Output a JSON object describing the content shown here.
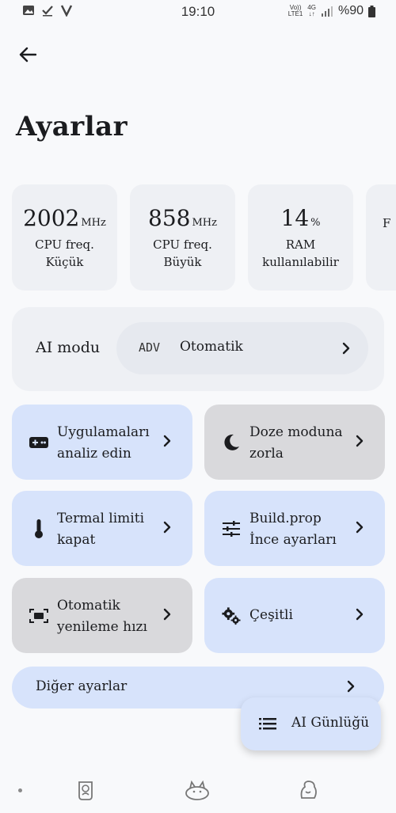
{
  "status_bar": {
    "time": "19:10",
    "network_top": "Vo))",
    "network_bottom": "LTE1",
    "signal_type": "4G",
    "battery": "%90",
    "left_icons": [
      "gallery-icon",
      "check-icon",
      "v-icon"
    ]
  },
  "header": {
    "title": "Ayarlar",
    "back_icon": "arrow-left-icon"
  },
  "stats": [
    {
      "value": "2002",
      "unit": "MHz",
      "label_line1": "CPU freq.",
      "label_line2": "Küçük"
    },
    {
      "value": "858",
      "unit": "MHz",
      "label_line1": "CPU freq.",
      "label_line2": "Büyük"
    },
    {
      "value": "14",
      "unit": "%",
      "label_line1": "RAM",
      "label_line2": "kullanılabilir"
    },
    {
      "value": "",
      "unit": "",
      "label_line1": "F",
      "label_line2": ""
    }
  ],
  "ai_mode": {
    "label": "AI modu",
    "badge": "ADV",
    "value": "Otomatik"
  },
  "tiles": [
    {
      "line1": "Uygulamaları",
      "line2": "analiz edin",
      "icon": "gamepad-icon"
    },
    {
      "line1": "Doze moduna",
      "line2": "zorla",
      "icon": "moon-icon"
    },
    {
      "line1": "Termal limiti",
      "line2": "kapat",
      "icon": "thermometer-icon"
    },
    {
      "line1": "Build.prop",
      "line2": "İnce ayarları",
      "icon": "sliders-icon"
    },
    {
      "line1": "Otomatik",
      "line2": "yenileme hızı",
      "icon": "screen-refresh-icon"
    },
    {
      "line1": "Çeşitli",
      "line2": "",
      "icon": "gears-icon"
    }
  ],
  "other": {
    "label": "Diğer ayarlar"
  },
  "fab": {
    "label": "AI Günlüğü",
    "icon": "list-icon"
  },
  "bottom_nav": [
    "nav-home-icon",
    "nav-cat-icon",
    "nav-profile-icon"
  ],
  "colors": {
    "background": "#f8f9fb",
    "card": "#eef0f4",
    "blue_tile": "#d7e3fb",
    "gray_tile": "#d9d9dc",
    "text": "#1b1c1f"
  }
}
